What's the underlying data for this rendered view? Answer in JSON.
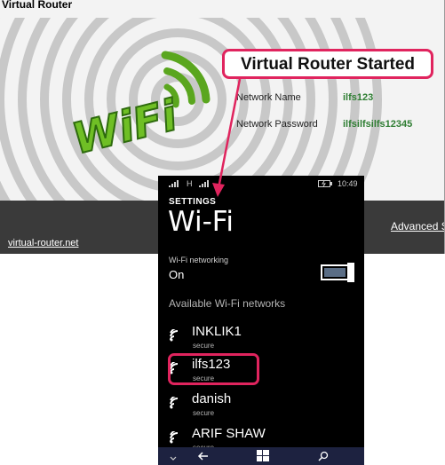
{
  "window": {
    "title": "Virtual Router",
    "status_message": "Virtual Router Started",
    "network_name_label": "Network Name",
    "network_name_value": "ilfs123",
    "network_password_label": "Network Password",
    "network_password_value": "ilfsilfsilfs12345",
    "footer_link": "virtual-router.net",
    "advanced_link": "Advanced S",
    "logo_text": "WiFi"
  },
  "phone": {
    "status_bar": {
      "carrier_indicator": "H",
      "time": "10:49",
      "battery_icon": "battery-charging-icon"
    },
    "section": "SETTINGS",
    "title": "Wi-Fi",
    "networking_label": "Wi-Fi networking",
    "networking_value": "On",
    "available_header": "Available Wi-Fi networks",
    "networks": [
      {
        "name": "INKLIK1",
        "status": "secure"
      },
      {
        "name": "ilfs123",
        "status": "secure"
      },
      {
        "name": "danish",
        "status": "secure"
      },
      {
        "name": "ARIF SHAW",
        "status": "secure"
      }
    ],
    "nav_icons": [
      "chevron-down-icon",
      "back-arrow-icon",
      "windows-logo-icon",
      "search-icon"
    ]
  },
  "colors": {
    "highlight": "#e0245e",
    "value_green": "#2e7d32",
    "phone_nav": "#1d2240"
  }
}
